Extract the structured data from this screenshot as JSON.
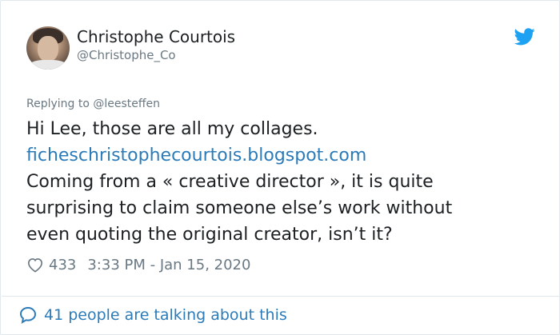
{
  "tweet": {
    "author_name": "Christophe Courtois",
    "author_handle": "@Christophe_Co",
    "replying_to": "Replying to @leesteffen",
    "lines": [
      "Hi Lee, those are all my collages.",
      "ficheschristophecourtois.blogspot.com",
      "Coming from a « creative director », it is quite",
      "surprising to claim someone else’s work without",
      "even quoting the original creator, isn’t it?"
    ],
    "likes": "433",
    "timestamp": "3:33 PM - Jan 15, 2020",
    "talking": "41 people are talking about this"
  },
  "colors": {
    "text": "#1c2022",
    "muted": "#697882",
    "link": "#2b7bb9",
    "twitter_blue": "#1da1f2",
    "border": "#e1e8ed"
  },
  "icons": {
    "brand": "twitter-bird-icon",
    "like": "heart-icon",
    "conversation": "speech-bubble-icon",
    "avatar": "avatar"
  }
}
